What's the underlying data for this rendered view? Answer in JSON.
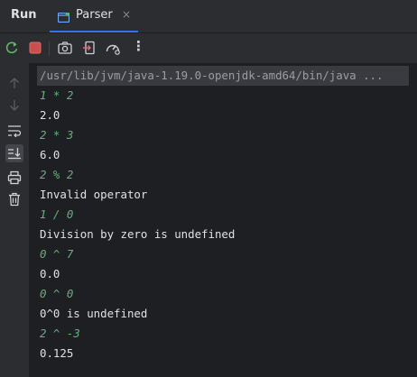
{
  "run_title": "Run",
  "tab": {
    "label": "Parser",
    "close": "×"
  },
  "toolbar": {
    "more": "⋮",
    "icons": [
      "rerun-icon",
      "stop-icon",
      "camera-icon",
      "exit-icon",
      "profiler-icon",
      "more-icon"
    ]
  },
  "gutter": {
    "icons": [
      "up-arrow-icon",
      "down-arrow-icon",
      "soft-wrap-icon",
      "scroll-to-end-icon",
      "print-icon",
      "trash-icon"
    ]
  },
  "console": {
    "command": "/usr/lib/jvm/java-1.19.0-openjdk-amd64/bin/java ...",
    "lines": [
      {
        "text": "1 * 2",
        "kind": "input"
      },
      {
        "text": "2.0",
        "kind": "output"
      },
      {
        "text": "2 * 3",
        "kind": "input"
      },
      {
        "text": "6.0",
        "kind": "output"
      },
      {
        "text": "2 % 2",
        "kind": "input"
      },
      {
        "text": "Invalid operator",
        "kind": "output"
      },
      {
        "text": "1 / 0",
        "kind": "input"
      },
      {
        "text": "Division by zero is undefined",
        "kind": "output"
      },
      {
        "text": "0 ^ 7",
        "kind": "input"
      },
      {
        "text": "0.0",
        "kind": "output"
      },
      {
        "text": "0 ^ 0",
        "kind": "input"
      },
      {
        "text": "0^0 is undefined",
        "kind": "output"
      },
      {
        "text": "2 ^ -3",
        "kind": "input"
      },
      {
        "text": "0.125",
        "kind": "output"
      }
    ]
  },
  "colors": {
    "accent": "#3574f0",
    "input_text": "#5fb57a",
    "stop": "#db5c5c",
    "rerun": "#5fb865"
  }
}
